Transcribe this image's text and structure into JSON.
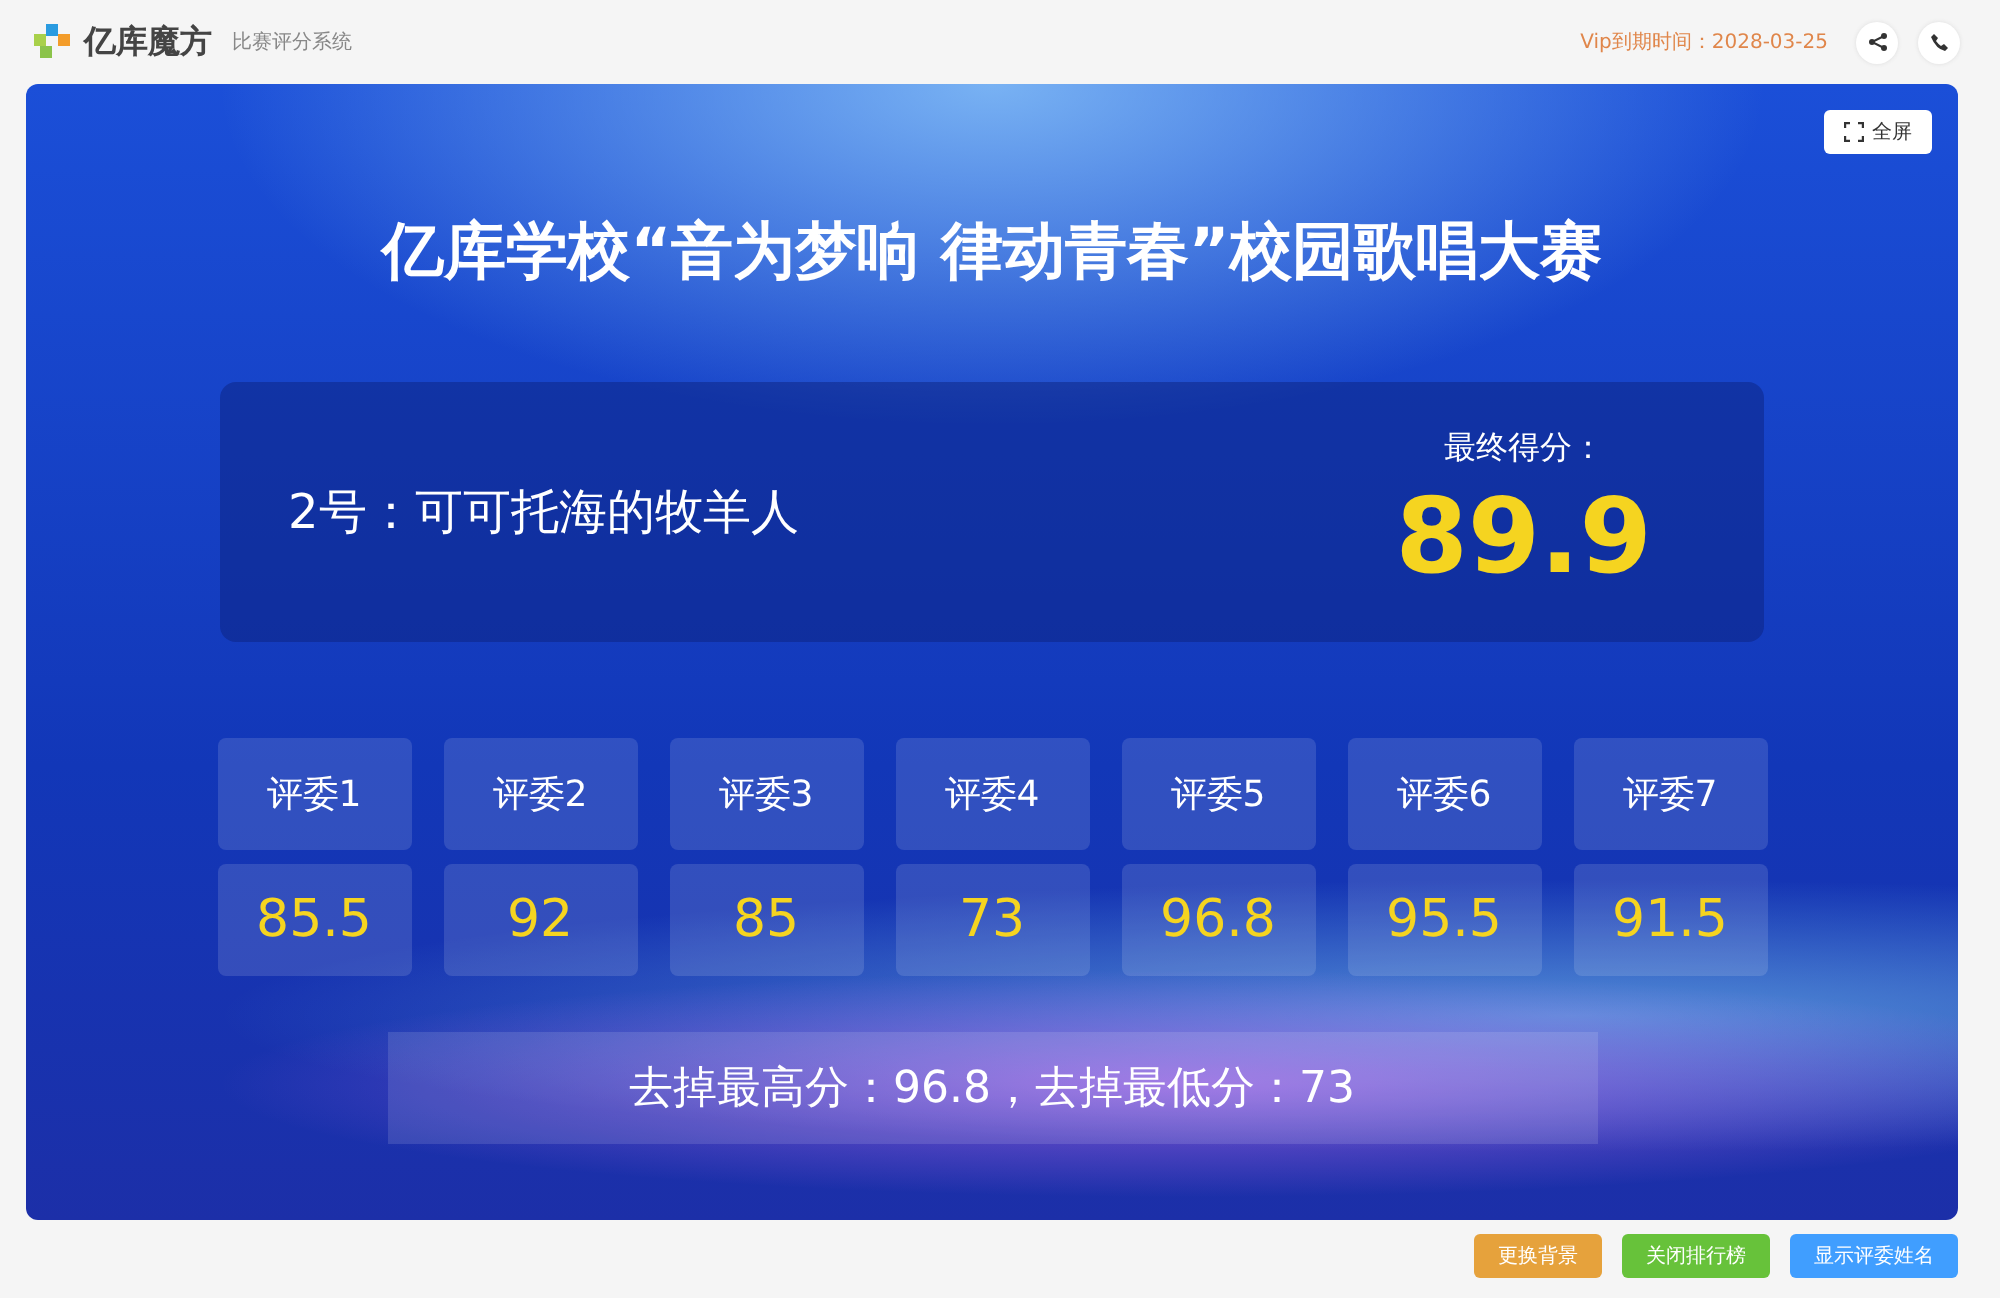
{
  "header": {
    "brand": "亿库魔方",
    "subtitle": "比赛评分系统",
    "vip": "Vip到期时间：2028-03-25"
  },
  "stage": {
    "fullscreen": "全屏",
    "title": "亿库学校“音为梦响 律动青春”校园歌唱大赛",
    "contestant": "2号：可可托海的牧羊人",
    "final_label": "最终得分：",
    "final_score": "89.9",
    "judges": [
      {
        "label": "评委1",
        "score": "85.5"
      },
      {
        "label": "评委2",
        "score": "92"
      },
      {
        "label": "评委3",
        "score": "85"
      },
      {
        "label": "评委4",
        "score": "73"
      },
      {
        "label": "评委5",
        "score": "96.8"
      },
      {
        "label": "评委6",
        "score": "95.5"
      },
      {
        "label": "评委7",
        "score": "91.5"
      }
    ],
    "note": "去掉最高分：96.8，去掉最低分：73"
  },
  "buttons": [
    {
      "label": "更换背景",
      "color": "#e6a23c"
    },
    {
      "label": "关闭排行榜",
      "color": "#67c23a"
    },
    {
      "label": "显示评委姓名",
      "color": "#409eff"
    }
  ]
}
